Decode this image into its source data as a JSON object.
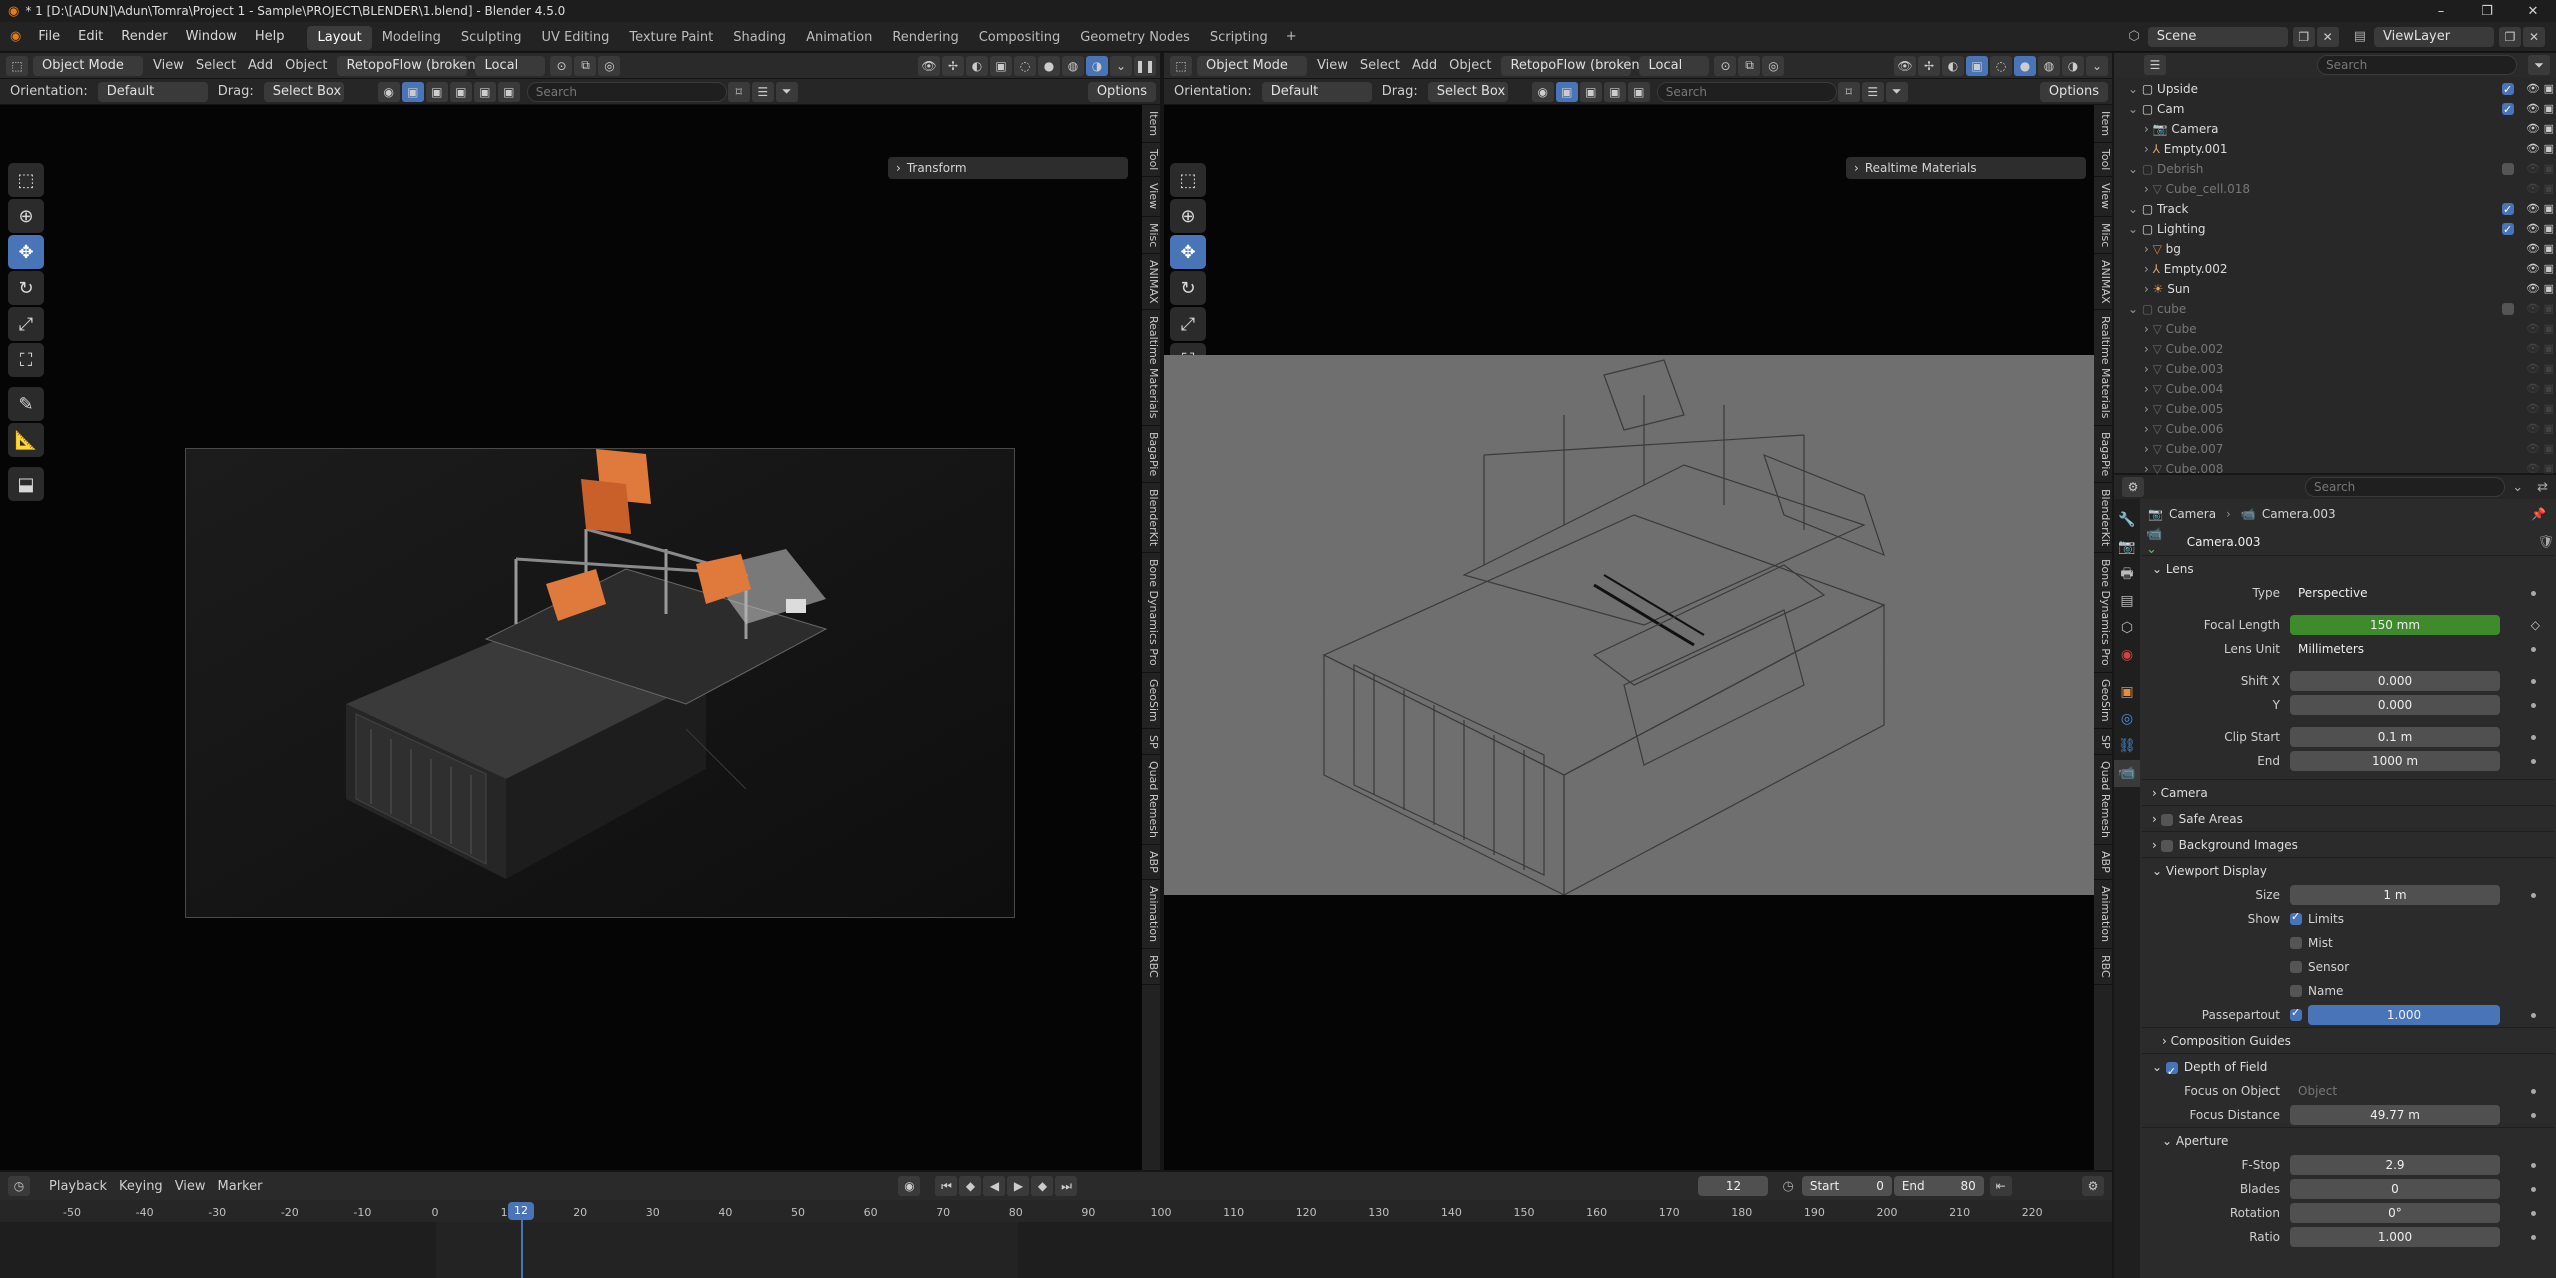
{
  "window": {
    "title": "* 1 [D:\\[ADUN]\\Adun\\Tomra\\Project 1 - Sample\\PROJECT\\BLENDER\\1.blend] - Blender 4.5.0"
  },
  "menu": {
    "items": [
      "File",
      "Edit",
      "Render",
      "Window",
      "Help"
    ]
  },
  "workspaces": [
    "Layout",
    "Modeling",
    "Sculpting",
    "UV Editing",
    "Texture Paint",
    "Shading",
    "Animation",
    "Rendering",
    "Compositing",
    "Geometry Nodes",
    "Scripting"
  ],
  "scene": {
    "name": "Scene",
    "view_layer": "ViewLayer"
  },
  "left_viewport": {
    "mode": "Object Mode",
    "menus": [
      "View",
      "Select",
      "Add",
      "Object"
    ],
    "addon": "RetopoFlow (broken)",
    "transform_space": "Local",
    "orientation_label": "Orientation:",
    "orientation_value": "Default",
    "drag_label": "Drag:",
    "drag_value": "Select Box",
    "search_placeholder": "Search",
    "options": "Options",
    "n_panel_title": "Transform",
    "side_tabs": [
      "Item",
      "Tool",
      "View",
      "Misc",
      "ANIMAX",
      "Realtime Materials",
      "BagaPie",
      "BlenderKit",
      "Bone Dynamics Pro",
      "GeoSim",
      "SP",
      "Quad Remesh",
      "ABP",
      "Animation",
      "RBC"
    ]
  },
  "right_viewport": {
    "mode": "Object Mode",
    "menus": [
      "View",
      "Select",
      "Add",
      "Object"
    ],
    "addon": "RetopoFlow (broken)",
    "transform_space": "Local",
    "orientation_label": "Orientation:",
    "orientation_value": "Default",
    "drag_label": "Drag:",
    "drag_value": "Select Box",
    "search_placeholder": "Search",
    "options": "Options",
    "n_panel_title": "Realtime Materials",
    "side_tabs": [
      "Item",
      "Tool",
      "View",
      "Misc",
      "ANIMAX",
      "Realtime Materials",
      "BagaPie",
      "BlenderKit",
      "Bone Dynamics Pro",
      "GeoSim",
      "SP",
      "Quad Remesh",
      "ABP",
      "Animation",
      "RBC"
    ]
  },
  "outliner": {
    "search_placeholder": "Search",
    "rows": [
      {
        "name": "Upside",
        "indent": 0,
        "kind": "collection",
        "dim": false
      },
      {
        "name": "Cam",
        "indent": 0,
        "kind": "collection",
        "dim": false
      },
      {
        "name": "Camera",
        "indent": 1,
        "kind": "camera",
        "dim": false
      },
      {
        "name": "Empty.001",
        "indent": 1,
        "kind": "empty",
        "dim": false
      },
      {
        "name": "Debrish",
        "indent": 0,
        "kind": "collection",
        "dim": true
      },
      {
        "name": "Cube_cell.018",
        "indent": 1,
        "kind": "mesh",
        "dim": true
      },
      {
        "name": "Track",
        "indent": 0,
        "kind": "collection",
        "dim": false
      },
      {
        "name": "Lighting",
        "indent": 0,
        "kind": "collection",
        "dim": false
      },
      {
        "name": "bg",
        "indent": 1,
        "kind": "mesh",
        "dim": false
      },
      {
        "name": "Empty.002",
        "indent": 1,
        "kind": "empty",
        "dim": false
      },
      {
        "name": "Sun",
        "indent": 1,
        "kind": "light",
        "dim": false
      },
      {
        "name": "cube",
        "indent": 0,
        "kind": "collection",
        "dim": true
      },
      {
        "name": "Cube",
        "indent": 1,
        "kind": "mesh",
        "dim": true
      },
      {
        "name": "Cube.002",
        "indent": 1,
        "kind": "mesh",
        "dim": true
      },
      {
        "name": "Cube.003",
        "indent": 1,
        "kind": "mesh",
        "dim": true
      },
      {
        "name": "Cube.004",
        "indent": 1,
        "kind": "mesh",
        "dim": true
      },
      {
        "name": "Cube.005",
        "indent": 1,
        "kind": "mesh",
        "dim": true
      },
      {
        "name": "Cube.006",
        "indent": 1,
        "kind": "mesh",
        "dim": true
      },
      {
        "name": "Cube.007",
        "indent": 1,
        "kind": "mesh",
        "dim": true
      },
      {
        "name": "Cube.008",
        "indent": 1,
        "kind": "mesh",
        "dim": true
      }
    ]
  },
  "properties": {
    "search_placeholder": "Search",
    "breadcrumb_object": "Camera",
    "breadcrumb_data": "Camera.003",
    "datablock_name": "Camera.003",
    "lens": {
      "header": "Lens",
      "type_label": "Type",
      "type_value": "Perspective",
      "focal_label": "Focal Length",
      "focal_value": "150 mm",
      "unit_label": "Lens Unit",
      "unit_value": "Millimeters",
      "shiftx_label": "Shift X",
      "shiftx_value": "0.000",
      "shifty_label": "Y",
      "shifty_value": "0.000",
      "clipstart_label": "Clip Start",
      "clipstart_value": "0.1 m",
      "clipend_label": "End",
      "clipend_value": "1000 m"
    },
    "camera_panel": "Camera",
    "safe_areas": "Safe Areas",
    "background_images": "Background Images",
    "viewport_display": {
      "header": "Viewport Display",
      "size_label": "Size",
      "size_value": "1 m",
      "show_label": "Show",
      "limits": "Limits",
      "mist": "Mist",
      "sensor": "Sensor",
      "name": "Name",
      "passepartout_label": "Passepartout",
      "passepartout_value": "1.000",
      "composition_guides": "Composition Guides"
    },
    "dof": {
      "header": "Depth of Field",
      "focus_object_label": "Focus on Object",
      "focus_object_placeholder": "Object",
      "focus_distance_label": "Focus Distance",
      "focus_distance_value": "49.77 m",
      "aperture": "Aperture",
      "fstop_label": "F-Stop",
      "fstop_value": "2.9",
      "blades_label": "Blades",
      "blades_value": "0",
      "rotation_label": "Rotation",
      "rotation_value": "0°",
      "ratio_label": "Ratio",
      "ratio_value": "1.000"
    }
  },
  "timeline": {
    "menus": [
      "Playback",
      "Keying",
      "View",
      "Marker"
    ],
    "current_frame": "12",
    "start_label": "Start",
    "start_value": "0",
    "end_label": "End",
    "end_value": "80",
    "ticks": [
      "-50",
      "-40",
      "-30",
      "-20",
      "-10",
      "0",
      "10",
      "20",
      "30",
      "40",
      "50",
      "60",
      "70",
      "80",
      "90",
      "100",
      "110",
      "120",
      "130",
      "140",
      "150",
      "160",
      "170",
      "180",
      "190",
      "200",
      "210",
      "220"
    ],
    "playhead_label": "12"
  },
  "colors": {
    "accent": "#4a74b8",
    "focal_green": "#3f8a2a",
    "orange": "#e07a3c"
  }
}
